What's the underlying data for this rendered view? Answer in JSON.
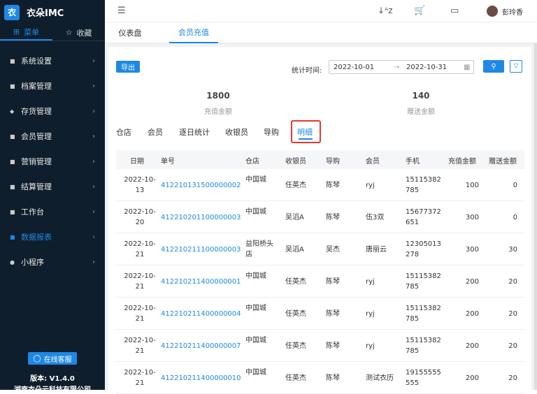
{
  "app": {
    "logo_mark": "衣",
    "name": "衣朵IMC"
  },
  "sidebar_tabs": [
    {
      "label": "菜单",
      "icon": "grid-icon"
    },
    {
      "label": "收藏",
      "icon": "star-icon"
    }
  ],
  "menu": [
    {
      "label": "系统设置",
      "icon": "settings-icon"
    },
    {
      "label": "档案管理",
      "icon": "archive-icon"
    },
    {
      "label": "存货管理",
      "icon": "box-icon"
    },
    {
      "label": "会员管理",
      "icon": "member-icon"
    },
    {
      "label": "营销管理",
      "icon": "marketing-icon"
    },
    {
      "label": "结算管理",
      "icon": "settlement-icon"
    },
    {
      "label": "工作台",
      "icon": "workbench-icon"
    },
    {
      "label": "数据报表",
      "icon": "report-icon"
    },
    {
      "label": "小程序",
      "icon": "miniapp-icon"
    }
  ],
  "customer_service": "在线客服",
  "version": "版本:  V1.4.0",
  "company": "湖南衣朵云科技有限公司",
  "user": {
    "name": "彭玲香"
  },
  "page_tabs": [
    "仪表盘",
    "会员充值"
  ],
  "toolbar": {
    "export": "导出",
    "stat_label": "统计时间:",
    "date_start": "2022-10-01",
    "date_end": "2022-10-31"
  },
  "kpis": [
    {
      "value": "1800",
      "label": "充值金额"
    },
    {
      "value": "140",
      "label": "赠送金额"
    }
  ],
  "report_tabs": [
    "仓店",
    "会员",
    "逐日统计",
    "收银员",
    "导购",
    "明细"
  ],
  "table": {
    "headers": [
      "日期",
      "单号",
      "仓店",
      "收银员",
      "导购",
      "会员",
      "手机",
      "充值金额",
      "赠送金额"
    ],
    "rows": [
      {
        "d1": "2022-10-",
        "d2": "13",
        "no": "412210131500000002",
        "s1": "中国城",
        "s2": "",
        "cashier": "任英杰",
        "guide": "陈琴",
        "member": "ryj",
        "p1": "15115382",
        "p2": "785",
        "amount": "100",
        "gift": "0"
      },
      {
        "d1": "2022-10-",
        "d2": "20",
        "no": "412210201100000003",
        "s1": "中国城",
        "s2": "",
        "cashier": "吴滔A",
        "guide": "陈琴",
        "member": "伍3双",
        "p1": "15677372",
        "p2": "651",
        "amount": "300",
        "gift": "0"
      },
      {
        "d1": "2022-10-",
        "d2": "21",
        "no": "412210211100000003",
        "s1": "益阳桥头",
        "s2": "店",
        "cashier": "吴滔A",
        "guide": "吴杰",
        "member": "唐丽云",
        "p1": "12305013",
        "p2": "278",
        "amount": "300",
        "gift": "30"
      },
      {
        "d1": "2022-10-",
        "d2": "21",
        "no": "412210211400000001",
        "s1": "中国城",
        "s2": "",
        "cashier": "任英杰",
        "guide": "陈琴",
        "member": "ryj",
        "p1": "15115382",
        "p2": "785",
        "amount": "200",
        "gift": "20"
      },
      {
        "d1": "2022-10-",
        "d2": "21",
        "no": "412210211400000004",
        "s1": "中国城",
        "s2": "",
        "cashier": "任英杰",
        "guide": "陈琴",
        "member": "ryj",
        "p1": "15115382",
        "p2": "785",
        "amount": "200",
        "gift": "20"
      },
      {
        "d1": "2022-10-",
        "d2": "21",
        "no": "412210211400000007",
        "s1": "中国城",
        "s2": "",
        "cashier": "任英杰",
        "guide": "陈琴",
        "member": "ryj",
        "p1": "15115382",
        "p2": "785",
        "amount": "200",
        "gift": "20"
      },
      {
        "d1": "2022-10-",
        "d2": "21",
        "no": "412210211400000010",
        "s1": "中国城",
        "s2": "",
        "cashier": "任英杰",
        "guide": "陈琴",
        "member": "测试衣历",
        "p1": "19155555",
        "p2": "555",
        "amount": "200",
        "gift": "20"
      }
    ]
  },
  "colors": {
    "accent": "#1e88e5",
    "sidebar_bg": "#0f1e2c",
    "highlight": "#e53935"
  }
}
